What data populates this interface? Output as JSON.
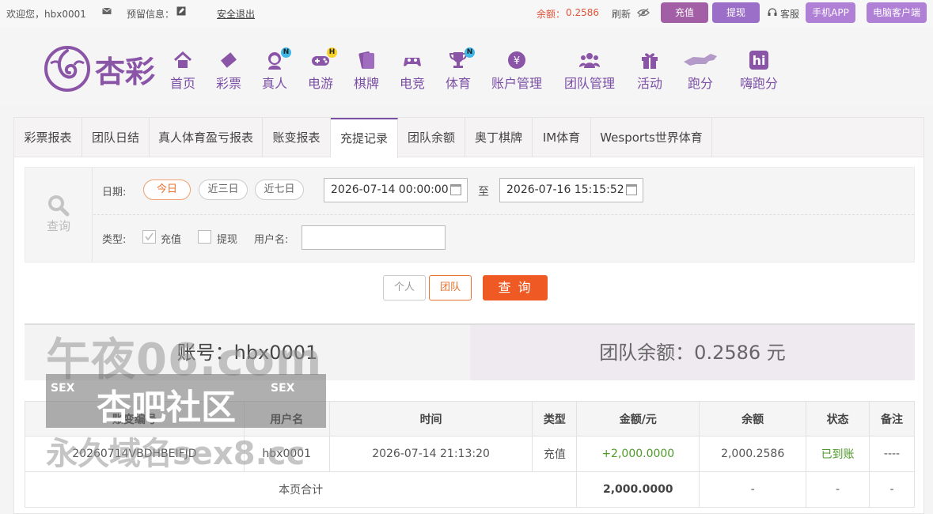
{
  "topbar": {
    "welcome": "欢迎您，hbx0001",
    "reserved_info": "预留信息：",
    "logout": "安全退出",
    "balance_label": "余额：",
    "balance_value": "0.2586",
    "refresh": "刷新",
    "deposit": "充值",
    "withdraw": "提现",
    "service": "客服",
    "mobile_app": "手机APP",
    "pc_client": "电脑客户端"
  },
  "brand": {
    "name": "杏彩"
  },
  "nav": {
    "items": [
      {
        "label": "首页"
      },
      {
        "label": "彩票"
      },
      {
        "label": "真人",
        "badge": "N"
      },
      {
        "label": "电游",
        "badge": "H"
      },
      {
        "label": "棋牌"
      },
      {
        "label": "电竞"
      },
      {
        "label": "体育",
        "badge": "N"
      },
      {
        "label": "账户管理"
      },
      {
        "label": "团队管理"
      },
      {
        "label": "活动"
      },
      {
        "label": "跑分"
      },
      {
        "label": "嗨跑分"
      }
    ]
  },
  "tabs": [
    "彩票报表",
    "团队日结",
    "真人体育盈亏报表",
    "账变报表",
    "充提记录",
    "团队余额",
    "奥丁棋牌",
    "IM体育",
    "Wesports世界体育"
  ],
  "query": {
    "side_label": "查询",
    "date_label": "日期:",
    "ranges": [
      "今日",
      "近三日",
      "近七日"
    ],
    "date_from": "2026-07-14 00:00:00",
    "to_label": "至",
    "date_to": "2026-07-16 15:15:52",
    "type_label": "类型:",
    "type_deposit": "充值",
    "type_withdraw": "提现",
    "username_label": "用户名:",
    "username_value": "",
    "btn_personal": "个人",
    "btn_team": "团队",
    "btn_query": "查 询"
  },
  "summary": {
    "account": "账号：hbx0001",
    "team_balance": "团队余额：0.2586 元"
  },
  "table": {
    "headers": [
      "账变编号",
      "用户名",
      "时间",
      "类型",
      "金额/元",
      "余额",
      "状态",
      "备注"
    ],
    "rows": [
      [
        "20260714VBDHBEIFJD",
        "hbx0001",
        "2026-07-14 21:13:20",
        "充值",
        "+2,000.0000",
        "2,000.2586",
        "已到账",
        "----"
      ]
    ],
    "total_label": "本页合计",
    "total_amount": "2,000.0000",
    "total_balance": "-",
    "total_status": "-",
    "total_note": "-"
  },
  "watermark": {
    "line1": "午夜06.com",
    "line2": "杏吧社区",
    "tag": "SEX",
    "line3": "永久域名sex8.cc"
  },
  "colors": {
    "brand_purple": "#7a4fa4",
    "button_purple": "#9b6fc8",
    "accent_orange": "#ef5a24",
    "amount_green": "#4e9a2b"
  }
}
